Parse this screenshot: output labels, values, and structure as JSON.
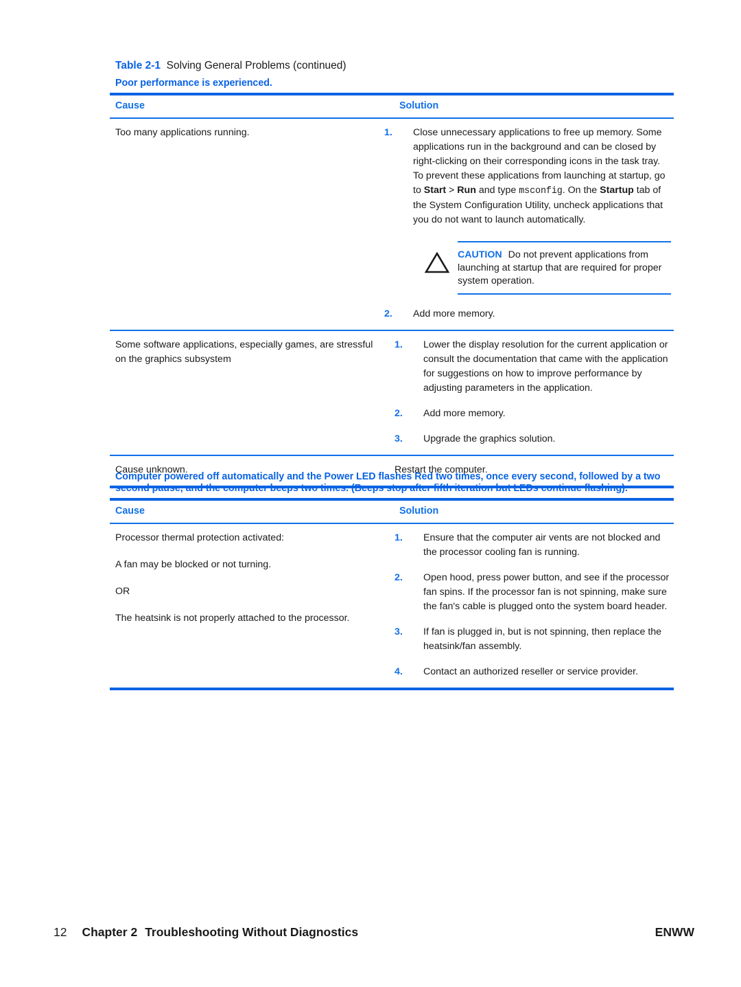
{
  "caption": {
    "label": "Table 2-1",
    "text": "Solving General Problems (continued)"
  },
  "colors": {
    "accent_blue": "#0a63e4",
    "header_blue": "#1170e8",
    "text_black": "#1a1a1a"
  },
  "tables": [
    {
      "title": "Poor performance is experienced.",
      "headers": {
        "cause": "Cause",
        "solution": "Solution"
      },
      "rows": [
        {
          "cause_paragraphs": [
            "Too many applications running."
          ],
          "solution_items": [
            {
              "num": "1.",
              "segments": [
                {
                  "type": "text",
                  "value": "Close unnecessary applications to free up memory. Some applications run in the background and can be closed by right-clicking on their corresponding icons in the task tray. To prevent these applications from launching at startup, go to "
                },
                {
                  "type": "bold",
                  "value": "Start"
                },
                {
                  "type": "text",
                  "value": " > "
                },
                {
                  "type": "bold",
                  "value": "Run"
                },
                {
                  "type": "text",
                  "value": " and type "
                },
                {
                  "type": "mono",
                  "value": "msconfig"
                },
                {
                  "type": "text",
                  "value": ". On the "
                },
                {
                  "type": "bold",
                  "value": "Startup"
                },
                {
                  "type": "text",
                  "value": " tab of the System Configuration Utility, uncheck applications that you do not want to launch automatically."
                }
              ],
              "caution": {
                "label": "CAUTION",
                "text": "Do not prevent applications from launching at startup that are required for proper system operation."
              }
            },
            {
              "num": "2.",
              "segments": [
                {
                  "type": "text",
                  "value": "Add more memory."
                }
              ]
            }
          ]
        },
        {
          "cause_paragraphs": [
            "Some software applications, especially games, are stressful on the graphics subsystem"
          ],
          "solution_items": [
            {
              "num": "1.",
              "segments": [
                {
                  "type": "text",
                  "value": "Lower the display resolution for the current application or consult the documentation that came with the application for suggestions on how to improve performance by adjusting parameters in the application."
                }
              ]
            },
            {
              "num": "2.",
              "segments": [
                {
                  "type": "text",
                  "value": "Add more memory."
                }
              ]
            },
            {
              "num": "3.",
              "segments": [
                {
                  "type": "text",
                  "value": "Upgrade the graphics solution."
                }
              ]
            }
          ]
        },
        {
          "cause_paragraphs": [
            "Cause unknown."
          ],
          "plain_solution": "Restart the computer."
        }
      ]
    },
    {
      "title": "Computer powered off automatically and the Power LED flashes Red two times, once every second, followed by a two second pause, and the computer beeps two times. (Beeps stop after fifth iteration but LEDs continue flashing).",
      "headers": {
        "cause": "Cause",
        "solution": "Solution"
      },
      "rows": [
        {
          "cause_paragraphs": [
            "Processor thermal protection activated:",
            "A fan may be blocked or not turning.",
            "OR",
            "The heatsink is not properly attached to the processor."
          ],
          "solution_items": [
            {
              "num": "1.",
              "segments": [
                {
                  "type": "text",
                  "value": "Ensure that the computer air vents are not blocked and the processor cooling fan is running."
                }
              ]
            },
            {
              "num": "2.",
              "segments": [
                {
                  "type": "text",
                  "value": "Open hood, press power button, and see if the processor fan spins. If the processor fan is not spinning, make sure the fan's cable is plugged onto the system board header."
                }
              ]
            },
            {
              "num": "3.",
              "segments": [
                {
                  "type": "text",
                  "value": "If fan is plugged in, but is not spinning, then replace the heatsink/fan assembly."
                }
              ]
            },
            {
              "num": "4.",
              "segments": [
                {
                  "type": "text",
                  "value": "Contact an authorized reseller or service provider."
                }
              ]
            }
          ]
        }
      ]
    }
  ],
  "footer": {
    "page_number": "12",
    "chapter": "Chapter 2",
    "chapter_title": "Troubleshooting Without Diagnostics",
    "right_label": "ENWW"
  }
}
